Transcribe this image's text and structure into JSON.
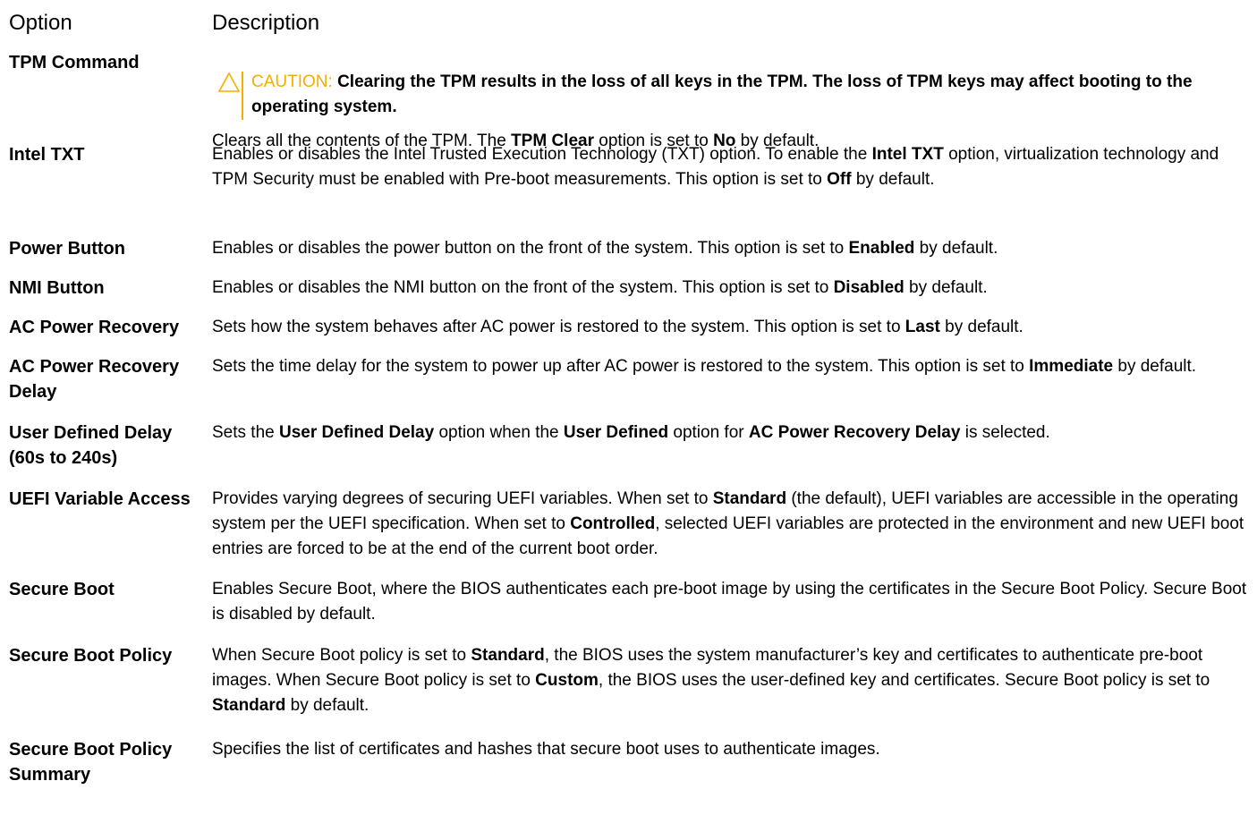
{
  "header": {
    "option": "Option",
    "description": "Description"
  },
  "colors": {
    "caution": "#f2af00",
    "text": "#000000"
  },
  "rows": {
    "tpm": {
      "option": "TPM Command",
      "caution_label": "CAUTION:",
      "caution_text": "Clearing the TPM results in the loss of all keys in the TPM. The loss of TPM keys may affect booting to the operating system.",
      "desc_1": "Clears all the contents of the TPM. The ",
      "desc_b1": "TPM Clear",
      "desc_2": " option is set to ",
      "desc_b2": "No",
      "desc_3": " by default."
    },
    "txt": {
      "option": "Intel TXT",
      "desc_1": "Enables or disables the Intel Trusted Execution Technology (TXT) option. To enable the ",
      "desc_b1": "Intel TXT",
      "desc_2": " option, virtualization technology and TPM Security must be enabled with Pre-boot measurements. This option is set to ",
      "desc_b2": "Off",
      "desc_3": " by default."
    },
    "power": {
      "option": "Power Button",
      "desc_1": "Enables or disables the power button on the front of the system. This option is set to ",
      "desc_b1": "Enabled",
      "desc_2": " by default."
    },
    "nmi": {
      "option": "NMI Button",
      "desc_1": "Enables or disables the NMI button on the front of the system. This option is set to ",
      "desc_b1": "Disabled",
      "desc_2": " by default."
    },
    "acpr": {
      "option": "AC Power Recovery",
      "desc_1": "Sets how the system behaves after AC power is restored to the system. This option is set to ",
      "desc_b1": "Last",
      "desc_2": " by default."
    },
    "acprd": {
      "option": "AC Power Recovery Delay",
      "desc_1": "Sets the time delay for the system to power up after AC power is restored to the system. This option is set to ",
      "desc_b1": "Immediate",
      "desc_2": " by default."
    },
    "udd": {
      "option": "User Defined Delay (60s to 240s)",
      "desc_1": "Sets the ",
      "desc_b1": "User Defined Delay",
      "desc_2": " option when the ",
      "desc_b2": "User Defined",
      "desc_3": " option for ",
      "desc_b3": "AC Power Recovery Delay",
      "desc_4": " is selected."
    },
    "uefi": {
      "option": "UEFI Variable Access",
      "desc_1": "Provides varying degrees of securing UEFI variables. When set to ",
      "desc_b1": "Standard",
      "desc_2": " (the default), UEFI variables are accessible in the operating system per the UEFI specification. When set to ",
      "desc_b2": "Controlled",
      "desc_3": ", selected UEFI variables are protected in the environment and new UEFI boot entries are forced to be at the end of the current boot order."
    },
    "sb": {
      "option": "Secure Boot",
      "desc_1": "Enables Secure Boot, where the BIOS authenticates each pre-boot image by using the certificates in the Secure Boot Policy. Secure Boot is disabled by default."
    },
    "sbp": {
      "option": "Secure Boot Policy",
      "desc_1": "When Secure Boot policy is set to ",
      "desc_b1": "Standard",
      "desc_2": ", the BIOS uses the system manufacturer’s key and certificates to authenticate pre-boot images. When Secure Boot policy is set to ",
      "desc_b2": "Custom",
      "desc_3": ", the BIOS uses the user-defined key and certificates. Secure Boot policy is set to ",
      "desc_b3": "Standard",
      "desc_4": " by default."
    },
    "sbps": {
      "option": "Secure Boot Policy Summary",
      "desc_1": "Specifies the list of certificates and hashes that secure boot uses to authenticate images."
    }
  }
}
